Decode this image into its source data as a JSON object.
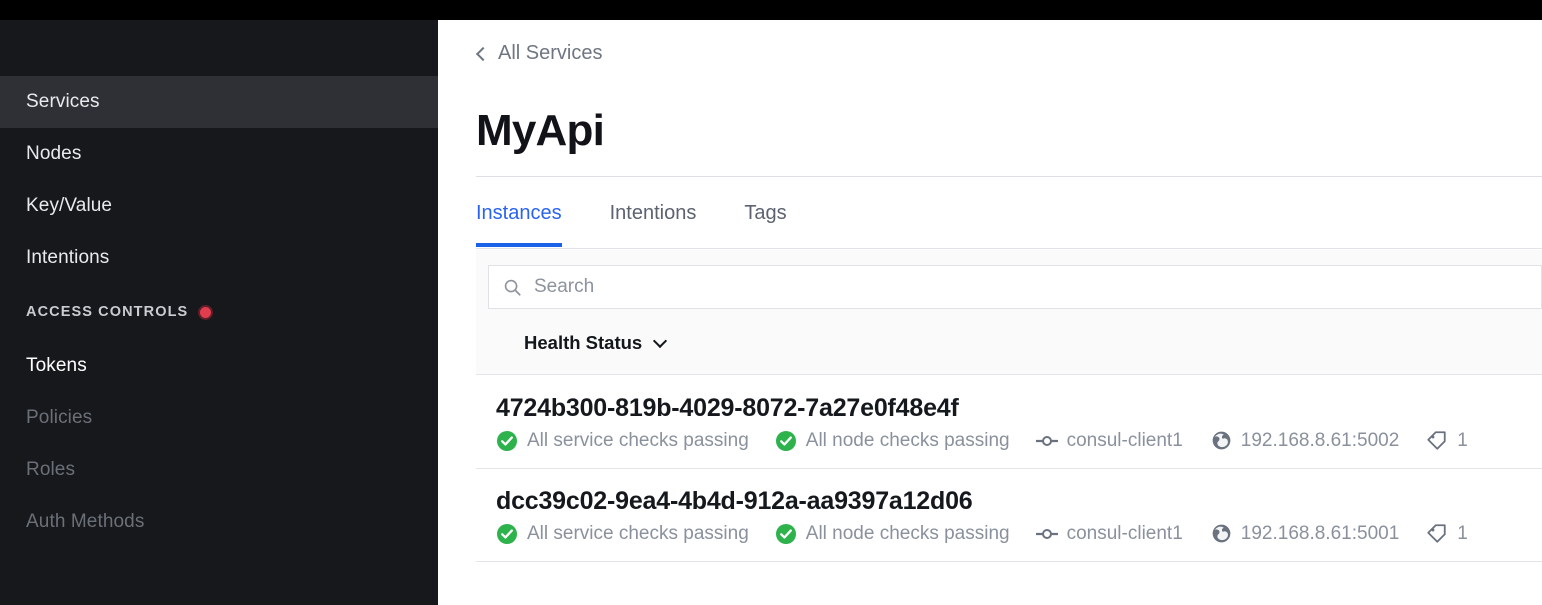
{
  "sidebar": {
    "items": [
      {
        "label": "Services",
        "state": "active"
      },
      {
        "label": "Nodes",
        "state": "normal"
      },
      {
        "label": "Key/Value",
        "state": "normal"
      },
      {
        "label": "Intentions",
        "state": "normal"
      }
    ],
    "section": {
      "label": "ACCESS CONTROLS",
      "badge_color": "#e03d4e"
    },
    "acl_items": [
      {
        "label": "Tokens",
        "state": "bright"
      },
      {
        "label": "Policies",
        "state": "dim"
      },
      {
        "label": "Roles",
        "state": "dim"
      },
      {
        "label": "Auth Methods",
        "state": "dim"
      }
    ]
  },
  "main": {
    "breadcrumb": "All Services",
    "title": "MyApi",
    "tabs": [
      {
        "label": "Instances",
        "active": true
      },
      {
        "label": "Intentions",
        "active": false
      },
      {
        "label": "Tags",
        "active": false
      }
    ],
    "search": {
      "value": "",
      "placeholder": "Search"
    },
    "filters": [
      {
        "label": "Health Status"
      }
    ],
    "instances": [
      {
        "id": "4724b300-819b-4029-8072-7a27e0f48e4f",
        "service_checks": "All service checks passing",
        "node_checks": "All node checks passing",
        "node": "consul-client1",
        "address": "192.168.8.61:5002",
        "tag_count": "1"
      },
      {
        "id": "dcc39c02-9ea4-4b4d-912a-aa9397a12d06",
        "service_checks": "All service checks passing",
        "node_checks": "All node checks passing",
        "node": "consul-client1",
        "address": "192.168.8.61:5001",
        "tag_count": "1"
      }
    ]
  },
  "colors": {
    "accent_blue": "#1b62e8",
    "sidebar_bg": "#16181c",
    "status_green": "#2eb24c",
    "badge_red": "#e03d4e"
  }
}
